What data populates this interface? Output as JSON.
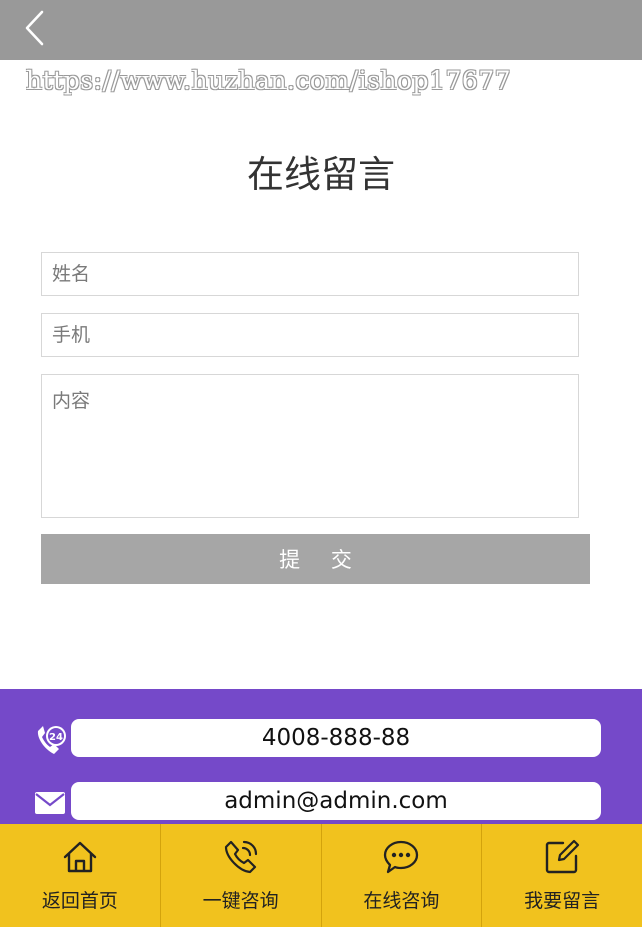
{
  "header": {
    "back_icon": "chevron-left-icon",
    "bg_color": "#999999"
  },
  "watermark": "https://www.huzhan.com/ishop17677",
  "page": {
    "title": "在线留言"
  },
  "form": {
    "name_placeholder": "姓名",
    "phone_placeholder": "手机",
    "content_placeholder": "内容",
    "submit_label": "提 交"
  },
  "contact": {
    "bg_color": "#7549c9",
    "phone": {
      "icon": "phone-24h-icon",
      "value": "4008-888-88"
    },
    "email": {
      "icon": "mail-icon",
      "value": "admin@admin.com"
    }
  },
  "tabbar": {
    "bg_color": "#f1c21e",
    "items": [
      {
        "icon": "home-icon",
        "label": "返回首页"
      },
      {
        "icon": "phone-call-icon",
        "label": "一键咨询"
      },
      {
        "icon": "chat-bubble-icon",
        "label": "在线咨询"
      },
      {
        "icon": "edit-icon",
        "label": "我要留言"
      }
    ]
  }
}
